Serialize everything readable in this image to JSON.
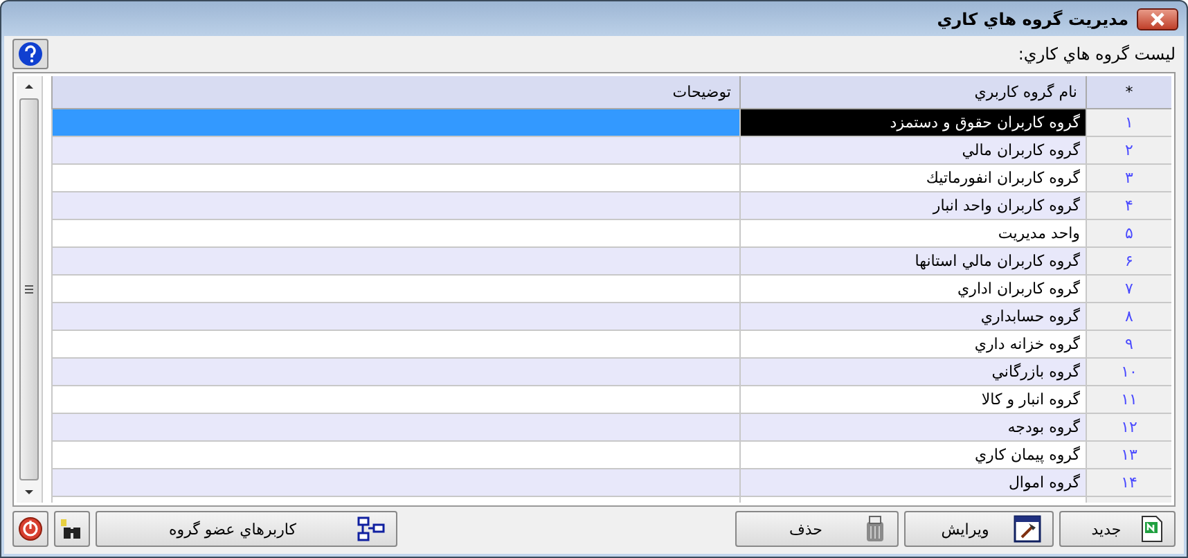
{
  "window": {
    "title": "مديريت گروه هاي کاري"
  },
  "list_label": "ليست گروه هاي کاري:",
  "table": {
    "columns": [
      "*",
      "نام گروه کاربري",
      "توضيحات"
    ],
    "rows": [
      {
        "number": "۱",
        "name": "گروه کاربران حقوق و دستمزد",
        "selected": true
      },
      {
        "number": "۲",
        "name": "گروه کاربران مالي",
        "selected": false
      },
      {
        "number": "۳",
        "name": "گروه کاربران انفورماتيك",
        "selected": false
      },
      {
        "number": "۴",
        "name": "گروه کاربران واحد انبار",
        "selected": false
      },
      {
        "number": "۵",
        "name": "واحد مديريت",
        "selected": false
      },
      {
        "number": "۶",
        "name": "گروه کاربران مالي استانها",
        "selected": false
      },
      {
        "number": "۷",
        "name": "گروه کاربران اداري",
        "selected": false
      },
      {
        "number": "۸",
        "name": "گروه حسابداري",
        "selected": false
      },
      {
        "number": "۹",
        "name": "گروه خزانه داري",
        "selected": false
      },
      {
        "number": "۱۰",
        "name": "گروه بازرگاني",
        "selected": false
      },
      {
        "number": "۱۱",
        "name": "گروه انبار و کالا",
        "selected": false
      },
      {
        "number": "۱۲",
        "name": "گروه بودجه",
        "selected": false
      },
      {
        "number": "۱۳",
        "name": "گروه پيمان کاري",
        "selected": false
      },
      {
        "number": "۱۴",
        "name": "گروه اموال",
        "selected": false
      }
    ]
  },
  "right_buttons": [
    {
      "kind": "new",
      "label": "جديد"
    },
    {
      "kind": "edit",
      "label": "ويرايش"
    },
    {
      "kind": "delete",
      "label": "حذف"
    }
  ],
  "left_buttons": [
    {
      "kind": "members",
      "label": "کاربرهاي عضو گروه"
    },
    {
      "kind": "find"
    },
    {
      "kind": "exit"
    }
  ]
}
